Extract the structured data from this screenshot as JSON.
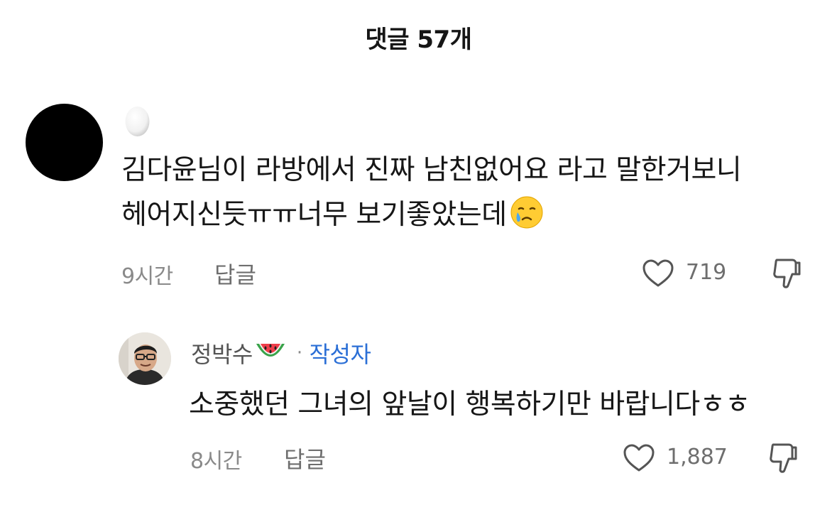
{
  "header": {
    "title": "댓글 57개"
  },
  "comment": {
    "username_icon": "egg-icon",
    "text_line1": "김다윤님이 라방에서 진짜 남친없어요 라고 말한거보니",
    "text_line2": "헤어지신듯ㅠㅠ너무 보기좋았는데",
    "emoji": "crying-face-emoji",
    "time": "9시간",
    "reply_label": "답글",
    "like_count": "719"
  },
  "reply": {
    "username": "정박수",
    "username_emoji": "watermelon-emoji",
    "separator": "·",
    "author_badge": "작성자",
    "text": "소중했던 그녀의 앞날이 행복하기만 바랍니다ㅎㅎ",
    "time": "8시간",
    "reply_label": "답글",
    "like_count": "1,887"
  },
  "colors": {
    "text": "#161616",
    "muted": "#8a8a8a",
    "author_badge": "#2b6fd6"
  }
}
